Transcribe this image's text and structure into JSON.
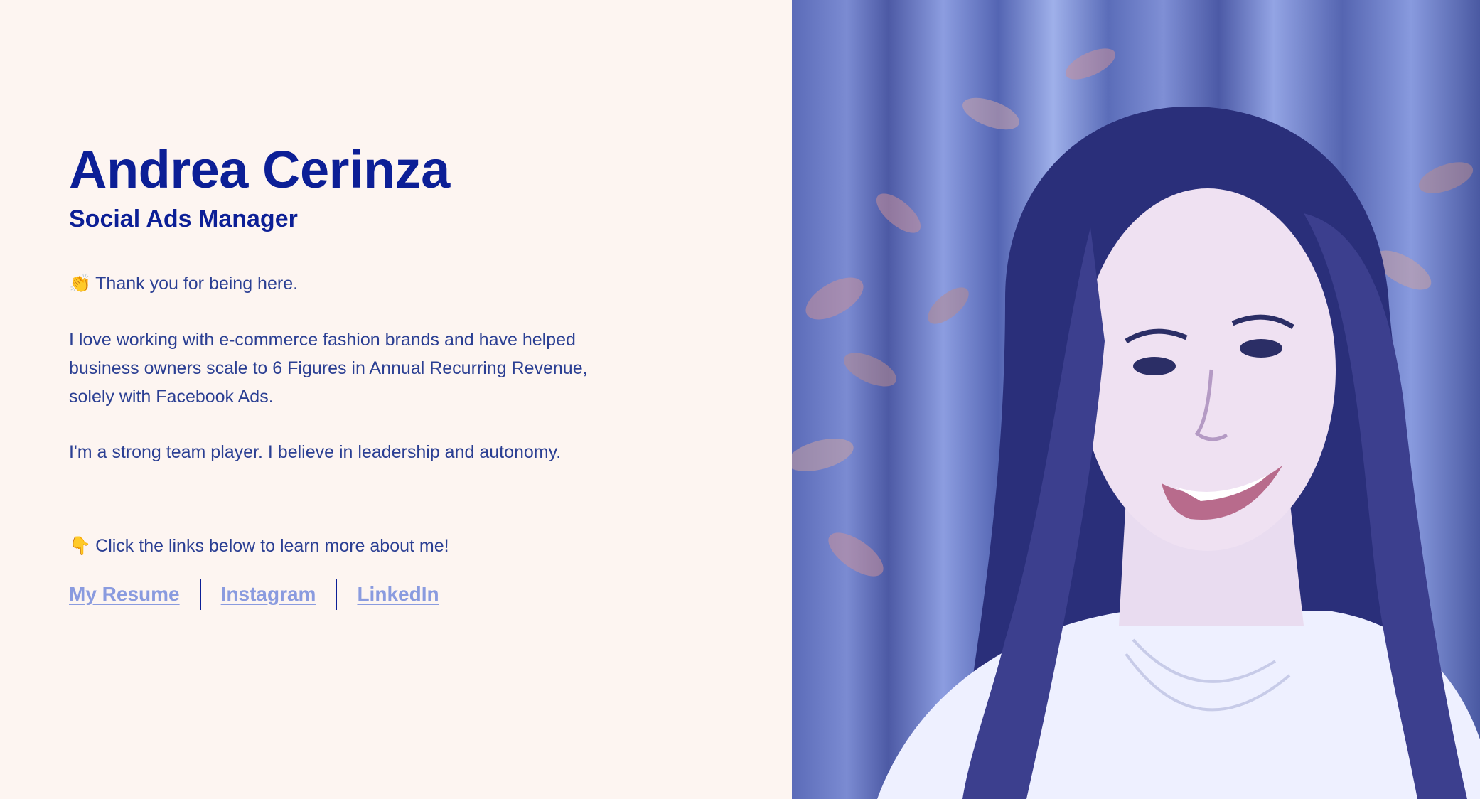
{
  "profile": {
    "name": "Andrea Cerinza",
    "role": "Social Ads Manager",
    "greeting_emoji": "👏",
    "greeting": "Thank you for being here.",
    "about": "I love working with e-commerce fashion brands and have helped business owners scale to 6 Figures in Annual Recurring Revenue, solely with Facebook Ads.",
    "team": "I'm a strong team player. I believe in leadership and autonomy.",
    "cta_emoji": "👇",
    "cta": "Click the links below to learn more about me!"
  },
  "links": [
    {
      "label": "My Resume"
    },
    {
      "label": "Instagram"
    },
    {
      "label": "LinkedIn"
    }
  ],
  "colors": {
    "panel_background": "#fdf5f1",
    "heading": "#0c1f96",
    "body_text": "#2b3f93",
    "link": "#8a9bdf"
  },
  "photo": {
    "icon": "portrait-photo"
  }
}
